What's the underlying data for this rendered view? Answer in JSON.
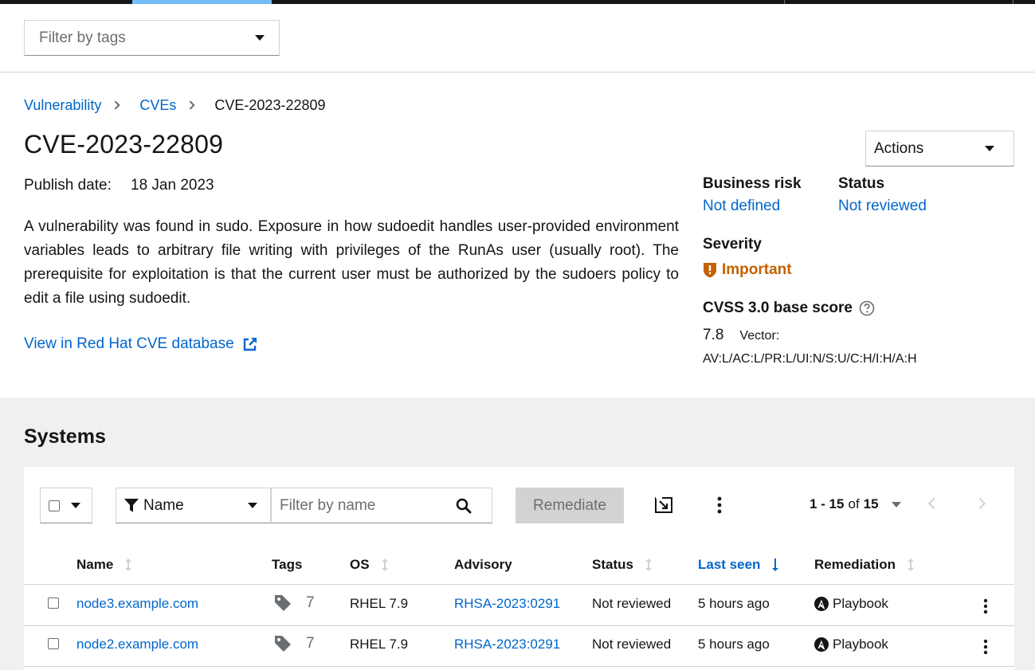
{
  "top_filter": {
    "placeholder": "Filter by tags"
  },
  "breadcrumb": [
    {
      "label": "Vulnerability"
    },
    {
      "label": "CVEs"
    },
    {
      "label": "CVE-2023-22809"
    }
  ],
  "page_title": "CVE-2023-22809",
  "actions_label": "Actions",
  "publish": {
    "label": "Publish date:",
    "value": "18 Jan 2023"
  },
  "description": "A vulnerability was found in sudo. Exposure in how sudoedit handles user-provided environment variables leads to arbitrary file writing with privileges of the RunAs user (usually root). The prerequisite for exploitation is that the current user must be authorized by the sudoers policy to edit a file using sudoedit.",
  "cve_db_link": "View in Red Hat CVE database",
  "business_risk": {
    "label": "Business risk",
    "value": "Not defined"
  },
  "status": {
    "label": "Status",
    "value": "Not reviewed"
  },
  "severity": {
    "label": "Severity",
    "value": "Important",
    "color": "#c46100"
  },
  "cvss": {
    "label": "CVSS 3.0 base score",
    "score": "7.8",
    "vector_label": "Vector:",
    "vector": "AV:L/AC:L/PR:L/UI:N/S:U/C:H/I:H/A:H"
  },
  "systems": {
    "title": "Systems",
    "filter_attr": "Name",
    "search_placeholder": "Filter by name",
    "remediate_label": "Remediate",
    "pagination": {
      "range": "1 - 15",
      "of": "of",
      "total": "15"
    },
    "columns": [
      "Name",
      "Tags",
      "OS",
      "Advisory",
      "Status",
      "Last seen",
      "Remediation"
    ],
    "rows": [
      {
        "name": "node3.example.com",
        "tags": "7",
        "os": "RHEL 7.9",
        "advisory": "RHSA-2023:0291",
        "status": "Not reviewed",
        "last_seen": "5 hours ago",
        "remediation": "Playbook"
      },
      {
        "name": "node2.example.com",
        "tags": "7",
        "os": "RHEL 7.9",
        "advisory": "RHSA-2023:0291",
        "status": "Not reviewed",
        "last_seen": "5 hours ago",
        "remediation": "Playbook"
      }
    ]
  },
  "colors": {
    "link": "#0066cc",
    "accent": "#73bcf7",
    "severity_important": "#c46100",
    "background_lower": "#f0f0f0"
  }
}
